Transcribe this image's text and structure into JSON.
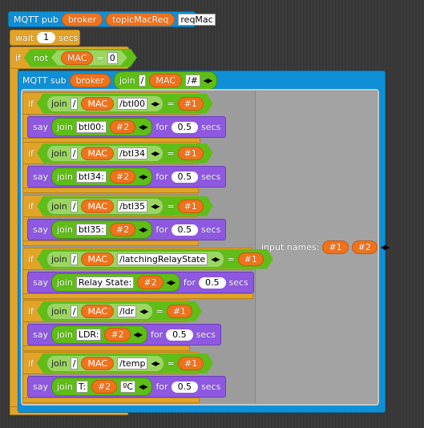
{
  "pub": {
    "label": "MQTT pub",
    "broker": "broker",
    "topic": "topicMacReq",
    "msg": "reqMac"
  },
  "wait": {
    "label": "wait",
    "value": "1",
    "unit": "secs"
  },
  "outer_if": {
    "label": "if",
    "not": "not",
    "var": "MAC",
    "eq": "=",
    "value": "0"
  },
  "sub": {
    "label": "MQTT sub",
    "broker": "broker",
    "join": "join",
    "slash": "/",
    "var": "MAC",
    "suffix": "/#",
    "input_names_label": "input names:",
    "params": [
      "#1",
      "#2"
    ]
  },
  "branches": [
    {
      "topic": "/btl00",
      "say": "btl00:",
      "unit": ""
    },
    {
      "topic": "/btl34",
      "say": "btl34:",
      "unit": ""
    },
    {
      "topic": "/btl35",
      "say": "btl35:",
      "unit": ""
    },
    {
      "topic": "/latchingRelayState",
      "say": "Relay State:",
      "unit": ""
    },
    {
      "topic": "/ldr",
      "say": "LDR:",
      "unit": ""
    },
    {
      "topic": "/temp",
      "say": "T:",
      "unit": "ºC"
    }
  ],
  "common": {
    "if": "if",
    "join": "join",
    "slash": "/",
    "var": "MAC",
    "eq": "=",
    "p1": "#1",
    "p2": "#2",
    "say": "say",
    "for": "for",
    "secs": "secs",
    "duration": "0.5"
  },
  "colors": {
    "control": "#e2a428",
    "other": "#0f90d6",
    "looks": "#8e58e0",
    "operators": "#5fbd17",
    "variables": "#f0731c"
  }
}
